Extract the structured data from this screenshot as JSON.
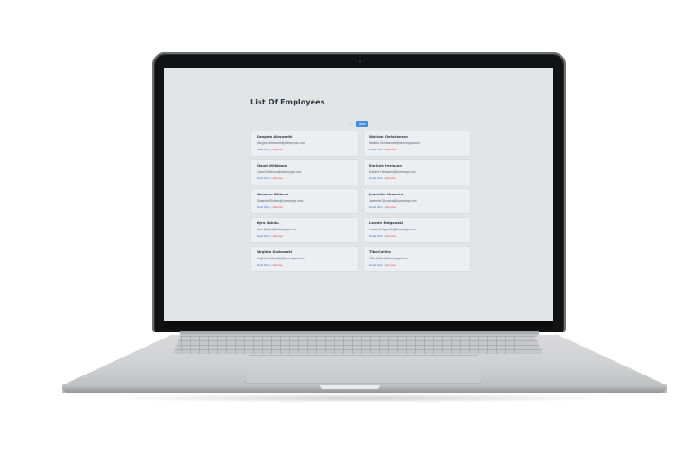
{
  "page": {
    "title": "List Of Employees"
  },
  "pagination": {
    "current_page": "1",
    "next_label": "Next"
  },
  "actions": {
    "read_more": "Read More",
    "separator": "|",
    "remove": "Remove"
  },
  "employees": [
    {
      "name": "Dangelo Ainsworth",
      "email": "Dangelo.Ainsworth@dummyapi.com"
    },
    {
      "name": "Waldon Christiansen",
      "email": "Waldon.Christiansen@dummyapi.com"
    },
    {
      "name": "Claud Wilkinson",
      "email": "Claud.Wilkinson@dummyapi.com"
    },
    {
      "name": "Earlene Hermann",
      "email": "Earlene.Hermann@dummyapi.com"
    },
    {
      "name": "Susanne Dickens",
      "email": "Susanne.Dickens@dummyapi.com"
    },
    {
      "name": "Jeanette Okuneva",
      "email": "Jeanette.Okuneva@dummyapi.com"
    },
    {
      "name": "Kyra Spinka",
      "email": "Kyra.Spinka@dummyapi.com"
    },
    {
      "name": "Lavern Kutgowski",
      "email": "Lavern.Kutgowski@dummyapi.com"
    },
    {
      "name": "Virginia Gutkowski",
      "email": "Virginia.Gutkowski@dummyapi.com"
    },
    {
      "name": "Tiko Collins",
      "email": "Tiko.Collins@dummyapi.com"
    }
  ],
  "colors": {
    "screen_bg": "#e2e4e6",
    "card_bg": "#eceef1",
    "link": "#3f7fc6",
    "danger": "#d8443a",
    "button": "#3f8ee0"
  }
}
